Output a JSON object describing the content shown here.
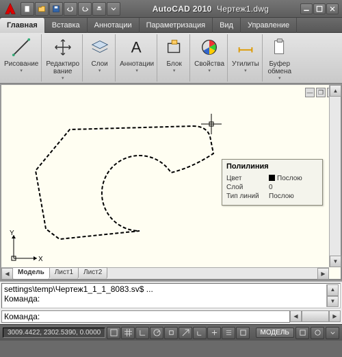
{
  "title": {
    "app": "AutoCAD 2010",
    "file": "Чертеж1.dwg"
  },
  "tabs": [
    "Главная",
    "Вставка",
    "Аннотации",
    "Параметризация",
    "Вид",
    "Управление"
  ],
  "active_tab": 0,
  "ribbon": [
    {
      "label": "Рисование"
    },
    {
      "label": "Редактиро\nвание"
    },
    {
      "label": "Слои"
    },
    {
      "label": "Аннотации"
    },
    {
      "label": "Блок"
    },
    {
      "label": "Свойства"
    },
    {
      "label": "Утилиты"
    },
    {
      "label": "Буфер\nобмена"
    }
  ],
  "tooltip": {
    "title": "Полилиния",
    "rows": [
      {
        "k": "Цвет",
        "v": "Послою",
        "swatch": true
      },
      {
        "k": "Слой",
        "v": "0"
      },
      {
        "k": "Тип линий",
        "v": "Послою"
      }
    ]
  },
  "ucs": {
    "x": "X",
    "y": "Y"
  },
  "bottom_tabs": [
    "Модель",
    "Лист1",
    "Лист2"
  ],
  "active_bottom_tab": 0,
  "cmd_log": "settings\\temp\\Чертеж1_1_1_8083.sv$ ...\nКоманда:",
  "cmd_prompt": "Команда:",
  "coords": "3009.4422, 2302.5390, 0.0000",
  "status_model": "МОДЕЛЬ"
}
